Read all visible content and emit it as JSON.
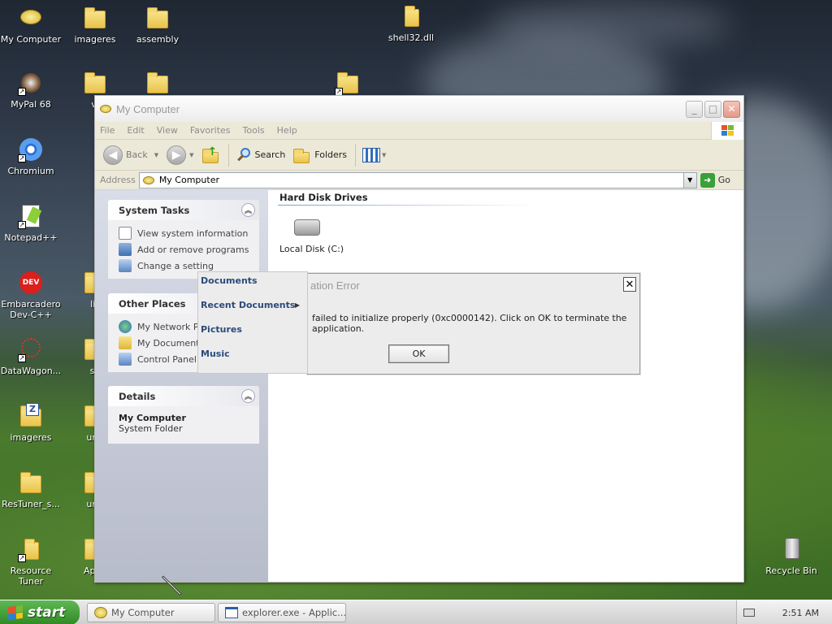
{
  "desktop": {
    "icons": [
      {
        "label": "My Computer",
        "icon": "my-computer-icon"
      },
      {
        "label": "imageres",
        "icon": "folder-icon"
      },
      {
        "label": "assembly",
        "icon": "folder-icon"
      },
      {
        "label": "shell32.dll",
        "icon": "folder-icon"
      },
      {
        "label": "MyPal 68",
        "icon": "mypal-icon"
      },
      {
        "label": "vi",
        "icon": "folder-icon"
      },
      {
        "label": "Chromium",
        "icon": "chromium-icon"
      },
      {
        "label": "Notepad++",
        "icon": "notepadpp-icon"
      },
      {
        "label": "Embarcadero Dev-C++",
        "icon": "devcpp-icon"
      },
      {
        "label": "lis",
        "icon": "folder-icon"
      },
      {
        "label": "DataWagon...",
        "icon": "datawagon-icon"
      },
      {
        "label": "sd",
        "icon": "folder-icon"
      },
      {
        "label": "imageres",
        "icon": "zip-icon"
      },
      {
        "label": "unti",
        "icon": "folder-icon"
      },
      {
        "label": "ResTuner_s...",
        "icon": "folder-icon"
      },
      {
        "label": "unti",
        "icon": "folder-icon"
      },
      {
        "label": "Resource Tuner",
        "icon": "resource-tuner-icon"
      },
      {
        "label": "AppP",
        "icon": "folder-icon"
      },
      {
        "label": "Recycle Bin",
        "icon": "recycle-bin-icon"
      }
    ]
  },
  "window": {
    "title": "My Computer",
    "menu": [
      "File",
      "Edit",
      "View",
      "Favorites",
      "Tools",
      "Help"
    ],
    "toolbar": {
      "back": "Back",
      "search": "Search",
      "folders": "Folders"
    },
    "address": {
      "label": "Address",
      "value": "My Computer",
      "go": "Go"
    },
    "side": {
      "system_tasks": {
        "title": "System Tasks",
        "items": [
          "View system information",
          "Add or remove programs",
          "Change a setting"
        ]
      },
      "other_places": {
        "title": "Other Places",
        "items": [
          "My Network Pla",
          "My Documents",
          "Control Panel"
        ]
      },
      "details": {
        "title": "Details",
        "name": "My Computer",
        "sub": "System Folder"
      }
    },
    "content": {
      "group": "Hard Disk Drives",
      "drive": "Local Disk (C:)"
    }
  },
  "popup_menu": {
    "items": [
      "Documents",
      "Recent Documents",
      "Pictures",
      "Music"
    ]
  },
  "dialog": {
    "title": "ation Error",
    "message": "failed to initialize properly (0xc0000142). Click on OK to terminate the application.",
    "ok": "OK"
  },
  "taskbar": {
    "start": "start",
    "buttons": [
      "My Computer",
      "explorer.exe - Applic..."
    ],
    "clock": "2:51 AM"
  }
}
